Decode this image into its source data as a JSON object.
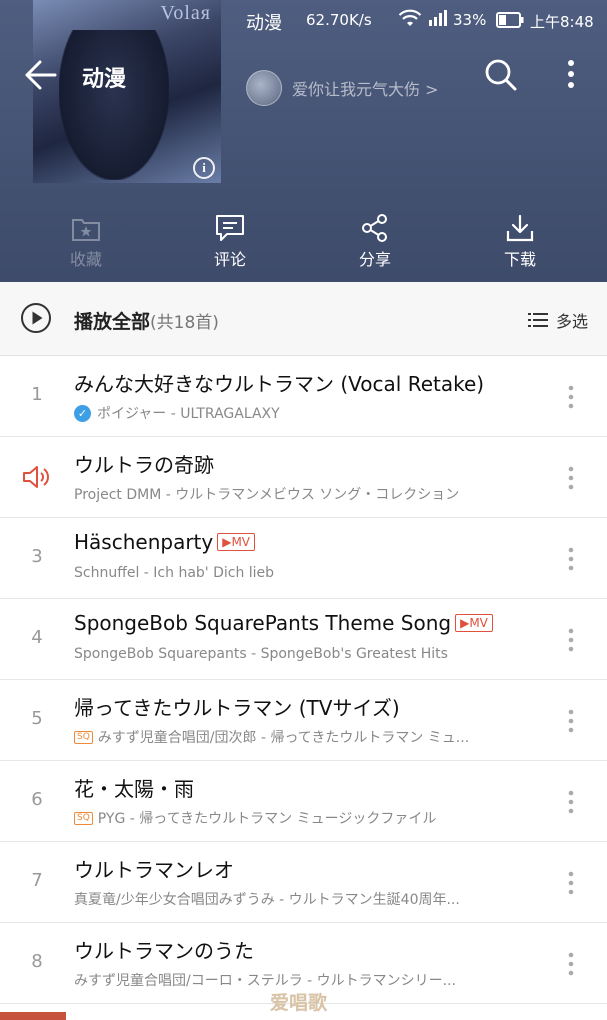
{
  "status_bar": {
    "app": "动漫",
    "speed": "62.70K/s",
    "battery": "33%",
    "time": "上午8:48"
  },
  "cover": {
    "title_text": "Volaя"
  },
  "header": {
    "title": "动漫",
    "user_name": "爱你让我元气大伤 >"
  },
  "actions": [
    {
      "label": "收藏",
      "icon": "folder-star-icon",
      "enabled": false
    },
    {
      "label": "评论",
      "icon": "comment-icon",
      "enabled": true
    },
    {
      "label": "分享",
      "icon": "share-icon",
      "enabled": true
    },
    {
      "label": "下载",
      "icon": "download-icon",
      "enabled": true
    }
  ],
  "playall": {
    "label": "播放全部",
    "count": "(共18首)",
    "multiselect": "多选"
  },
  "tracks": [
    {
      "index": "1",
      "title": "みんな大好きなウルトラマン (Vocal Retake)",
      "subtitle": "ポイジャー - ULTRAGALAXY",
      "verified": true,
      "sq": false,
      "mv": false,
      "playing": false
    },
    {
      "index": "2",
      "title": "ウルトラの奇跡",
      "subtitle": "Project DMM - ウルトラマンメビウス ソング・コレクション",
      "verified": false,
      "sq": false,
      "mv": false,
      "playing": true
    },
    {
      "index": "3",
      "title": "Häschenparty",
      "subtitle": "Schnuffel - Ich hab' Dich lieb",
      "verified": false,
      "sq": false,
      "mv": true,
      "playing": false
    },
    {
      "index": "4",
      "title": "SpongeBob SquarePants Theme Song",
      "subtitle": "SpongeBob Squarepants - SpongeBob's Greatest Hits",
      "verified": false,
      "sq": false,
      "mv": true,
      "playing": false
    },
    {
      "index": "5",
      "title": "帰ってきたウルトラマン (TVサイズ)",
      "subtitle": "みすず児童合唱団/団次郎 - 帰ってきたウルトラマン ミュ...",
      "verified": false,
      "sq": true,
      "mv": false,
      "playing": false
    },
    {
      "index": "6",
      "title": "花・太陽・雨",
      "subtitle": "PYG - 帰ってきたウルトラマン ミュージックファイル",
      "verified": false,
      "sq": true,
      "mv": false,
      "playing": false
    },
    {
      "index": "7",
      "title": "ウルトラマンレオ",
      "subtitle": "真夏竜/少年少女合唱団みずうみ - ウルトラマン生誕40周年...",
      "verified": false,
      "sq": false,
      "mv": false,
      "playing": false
    },
    {
      "index": "8",
      "title": "ウルトラマンのうた",
      "subtitle": "みすず児童合唱団/コーロ・ステルラ - ウルトラマンシリー...",
      "verified": false,
      "sq": false,
      "mv": false,
      "playing": false
    }
  ],
  "badges": {
    "mv": "▶MV",
    "sq": "SQ",
    "verified": "✓"
  },
  "watermark": "爱唱歌",
  "colors": {
    "header_bg": "#445273",
    "accent_red": "#e0513d",
    "verified_blue": "#3f9fe6",
    "sq_orange": "#ee8a3a"
  }
}
